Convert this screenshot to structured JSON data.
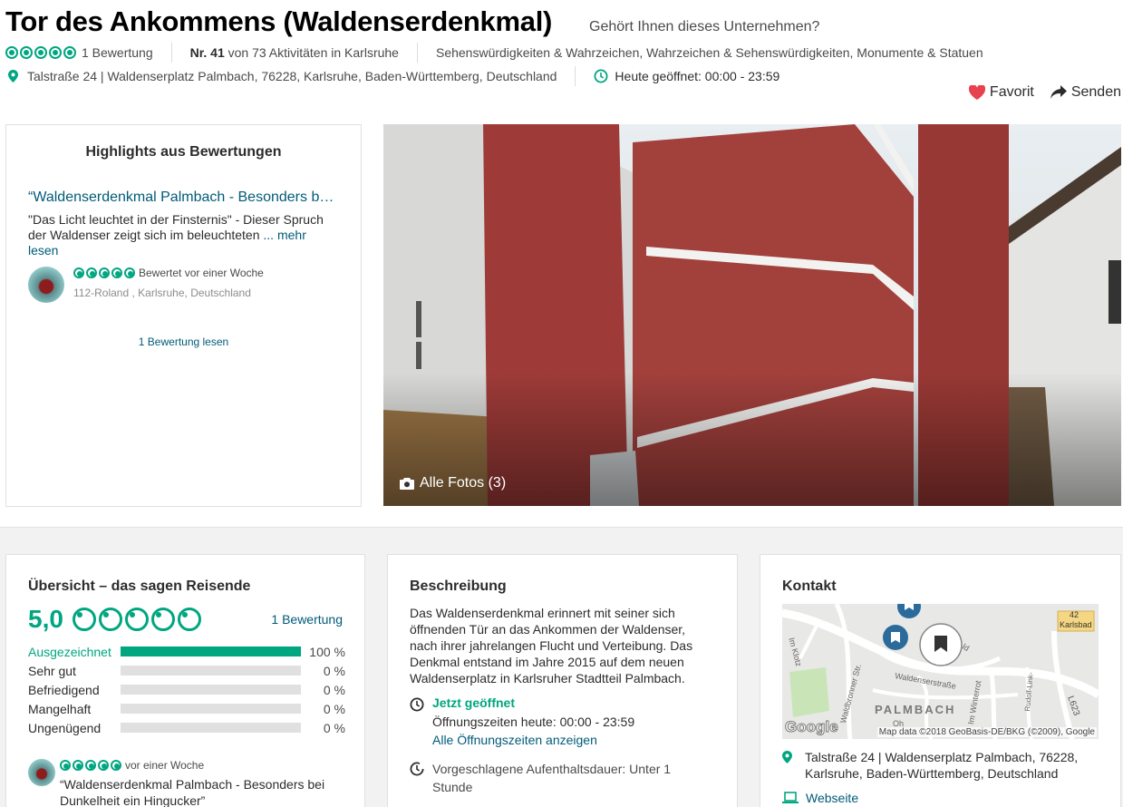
{
  "header": {
    "title": "Tor des Ankommens (Waldenserdenkmal)",
    "claim": "Gehört Ihnen dieses Unternehmen?",
    "rating_bubbles": 5,
    "review_count": "1 Bewertung",
    "rank_bold": "Nr. 41",
    "rank_rest": "von 73 Aktivitäten in Karlsruhe",
    "categories": "Sehenswürdigkeiten & Wahrzeichen, Wahrzeichen & Sehenswürdigkeiten, Monumente & Statuen",
    "address": "Talstraße 24 | Waldenserplatz Palmbach, 76228, Karlsruhe, Baden-Württemberg, Deutschland",
    "hours": "Heute geöffnet: 00:00 - 23:59",
    "favorite_label": "Favorit",
    "share_label": "Senden"
  },
  "highlights": {
    "title": "Highlights aus Bewertungen",
    "review_title": "“Waldenserdenkmal Palmbach - Besonders b…",
    "review_text": "\"Das Licht leuchtet in der Finsternis\" - Dieser Spruch der Waldenser zeigt sich im beleuchteten",
    "more_ellipsis": "...",
    "more_label": "mehr lesen",
    "rated": "Bewertet vor einer Woche",
    "reviewer": "112-Roland",
    "reviewer_location": ", Karlsruhe, Deutschland",
    "read_link": "1 Bewertung lesen"
  },
  "photo": {
    "all_photos": "Alle Fotos (3)"
  },
  "overview": {
    "title": "Übersicht – das sagen Reisende",
    "score": "5,0",
    "review_link": "1 Bewertung",
    "ratings": [
      {
        "label": "Ausgezeichnet",
        "percent": "100 %",
        "fill": 100,
        "highlight": true
      },
      {
        "label": "Sehr gut",
        "percent": "0 %",
        "fill": 0,
        "highlight": false
      },
      {
        "label": "Befriedigend",
        "percent": "0 %",
        "fill": 0,
        "highlight": false
      },
      {
        "label": "Mangelhaft",
        "percent": "0 %",
        "fill": 0,
        "highlight": false
      },
      {
        "label": "Ungenügend",
        "percent": "0 %",
        "fill": 0,
        "highlight": false
      }
    ],
    "snippet_time": "vor einer Woche",
    "snippet_text": "“Waldenserdenkmal Palmbach - Besonders bei Dunkelheit ein Hingucker”"
  },
  "description": {
    "title": "Beschreibung",
    "text": "Das Waldenserdenkmal erinnert mit seiner sich öffnenden Tür an das Ankommen der Waldenser, nach ihrer jahrelangen Flucht und Verteibung. Das Denkmal entstand im Jahre 2015 auf dem neuen Waldenserplatz in Karlsruher Stadtteil Palmbach.",
    "open_now": "Jetzt geöffnet",
    "hours_today": "Öffnungszeiten heute: 00:00 - 23:59",
    "all_hours": "Alle Öffnungszeiten anzeigen",
    "duration": "Vorgeschlagene Aufenthaltsdauer: Unter 1 Stunde"
  },
  "contact": {
    "title": "Kontakt",
    "map_labels": {
      "district": "PALMBACH",
      "street1": "Waldenserstraße",
      "street2": "Waldbronner Str.",
      "street3": "Im Klotz",
      "street4": "Im Winterrot",
      "street5": "Rudolf-Link-",
      "road": "L623",
      "karlsbad": "Karlsbad",
      "road_num": "42",
      "oh": "Oh",
      "pld": "ld",
      "attribution": "Map data ©2018 GeoBasis-DE/BKG (©2009), Google",
      "google": "Google"
    },
    "address": "Talstraße 24 | Waldenserplatz Palmbach, 76228, Karlsruhe, Baden-Württemberg, Deutschland",
    "website_label": "Webseite"
  },
  "colors": {
    "accent": "#00a680",
    "link": "#005b78",
    "favorite": "#e8414f",
    "stone_red": "#9e3b38"
  }
}
